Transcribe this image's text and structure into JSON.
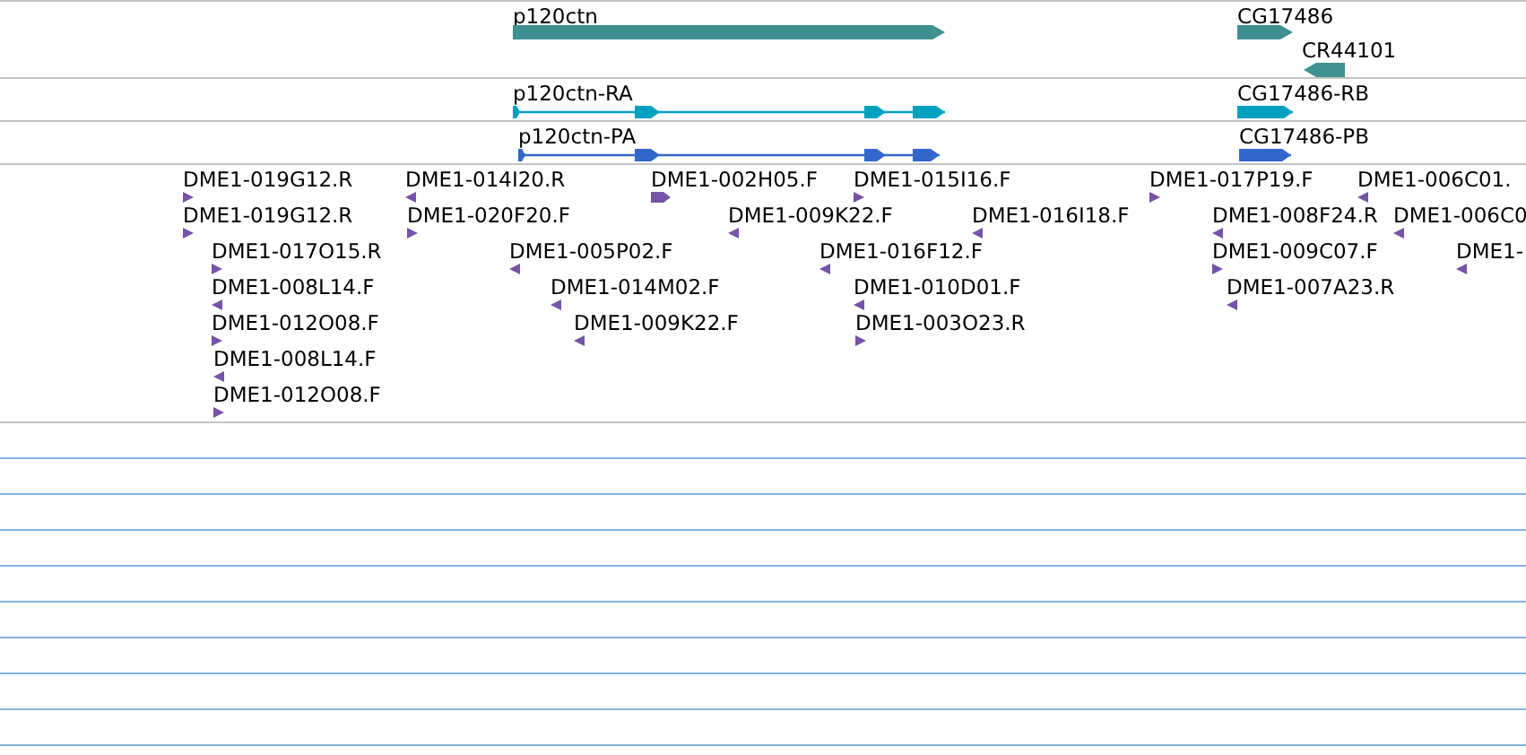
{
  "tracks": [
    {
      "kind": "gene",
      "features": [
        {
          "label": "p120ctn",
          "reverse": false
        },
        {
          "label": "CG17486",
          "reverse": false
        },
        {
          "label": "CR44101",
          "reverse": true
        }
      ]
    },
    {
      "kind": "transcript",
      "features": [
        {
          "label": "p120ctn-RA",
          "reverse": false
        },
        {
          "label": "CG17486-RB",
          "reverse": false
        }
      ]
    },
    {
      "kind": "protein",
      "features": [
        {
          "label": "p120ctn-PA",
          "reverse": false
        },
        {
          "label": "CG17486-PB",
          "reverse": false
        }
      ]
    },
    {
      "kind": "clone",
      "features": [
        {
          "label": "DME1-019G12.R",
          "reverse": false
        },
        {
          "label": "DME1-014I20.R",
          "reverse": true
        },
        {
          "label": "DME1-002H05.F",
          "reverse": false
        },
        {
          "label": "DME1-015I16.F",
          "reverse": false
        },
        {
          "label": "DME1-017P19.F",
          "reverse": false
        },
        {
          "label": "DME1-006C01.",
          "reverse": true
        },
        {
          "label": "DME1-019G12.R",
          "reverse": false
        },
        {
          "label": "DME1-020F20.F",
          "reverse": false
        },
        {
          "label": "DME1-009K22.F",
          "reverse": true
        },
        {
          "label": "DME1-016I18.F",
          "reverse": true
        },
        {
          "label": "DME1-008F24.R",
          "reverse": true
        },
        {
          "label": "DME1-006C0",
          "reverse": true
        },
        {
          "label": "DME1-017O15.R",
          "reverse": false
        },
        {
          "label": "DME1-005P02.F",
          "reverse": true
        },
        {
          "label": "DME1-016F12.F",
          "reverse": true
        },
        {
          "label": "DME1-009C07.F",
          "reverse": false
        },
        {
          "label": "DME1-",
          "reverse": true
        },
        {
          "label": "DME1-008L14.F",
          "reverse": true
        },
        {
          "label": "DME1-014M02.F",
          "reverse": true
        },
        {
          "label": "DME1-010D01.F",
          "reverse": true
        },
        {
          "label": "DME1-007A23.R",
          "reverse": true
        },
        {
          "label": "DME1-012O08.F",
          "reverse": false
        },
        {
          "label": "DME1-009K22.F",
          "reverse": true
        },
        {
          "label": "DME1-003O23.R",
          "reverse": false
        },
        {
          "label": "DME1-008L14.F",
          "reverse": true
        },
        {
          "label": "DME1-012O08.F",
          "reverse": false
        }
      ]
    }
  ]
}
